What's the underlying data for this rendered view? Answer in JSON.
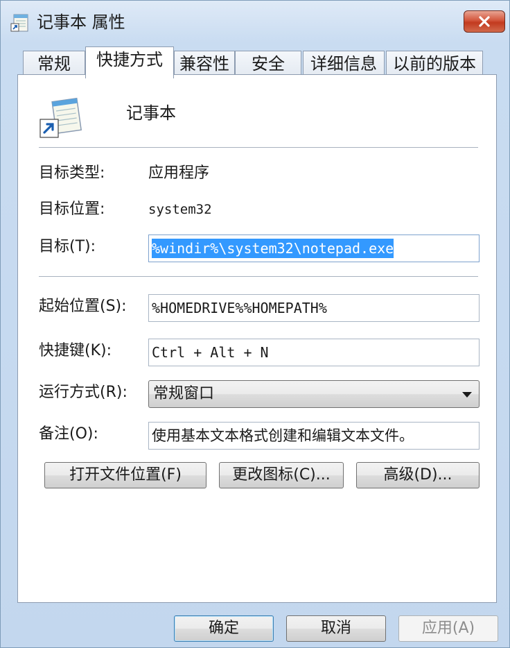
{
  "window": {
    "title": "记事本 属性",
    "title_icon": "notepad-icon",
    "close_icon": "close-icon"
  },
  "tabs": [
    {
      "label": "常规"
    },
    {
      "label": "快捷方式",
      "active": true
    },
    {
      "label": "兼容性"
    },
    {
      "label": "安全"
    },
    {
      "label": "详细信息"
    },
    {
      "label": "以前的版本"
    }
  ],
  "shortcut": {
    "app_name": "记事本",
    "target_type_label": "目标类型:",
    "target_type_value": "应用程序",
    "target_location_label": "目标位置:",
    "target_location_value": "system32",
    "target_label": "目标(T):",
    "target_value": "%windir%\\system32\\notepad.exe",
    "start_in_label": "起始位置(S):",
    "start_in_value": "%HOMEDRIVE%%HOMEPATH%",
    "hotkey_label": "快捷键(K):",
    "hotkey_value": "Ctrl + Alt + N",
    "run_label": "运行方式(R):",
    "run_value": "常规窗口",
    "comment_label": "备注(O):",
    "comment_value": "使用基本文本格式创建和编辑文本文件。",
    "open_location_button": "打开文件位置(F)",
    "change_icon_button": "更改图标(C)...",
    "advanced_button": "高级(D)..."
  },
  "footer": {
    "ok_label": "确定",
    "cancel_label": "取消",
    "apply_label": "应用(A)"
  },
  "colors": {
    "selection": "#3399ff",
    "close_button": "#c23a1f",
    "title_bar": "#c9dcf1"
  }
}
